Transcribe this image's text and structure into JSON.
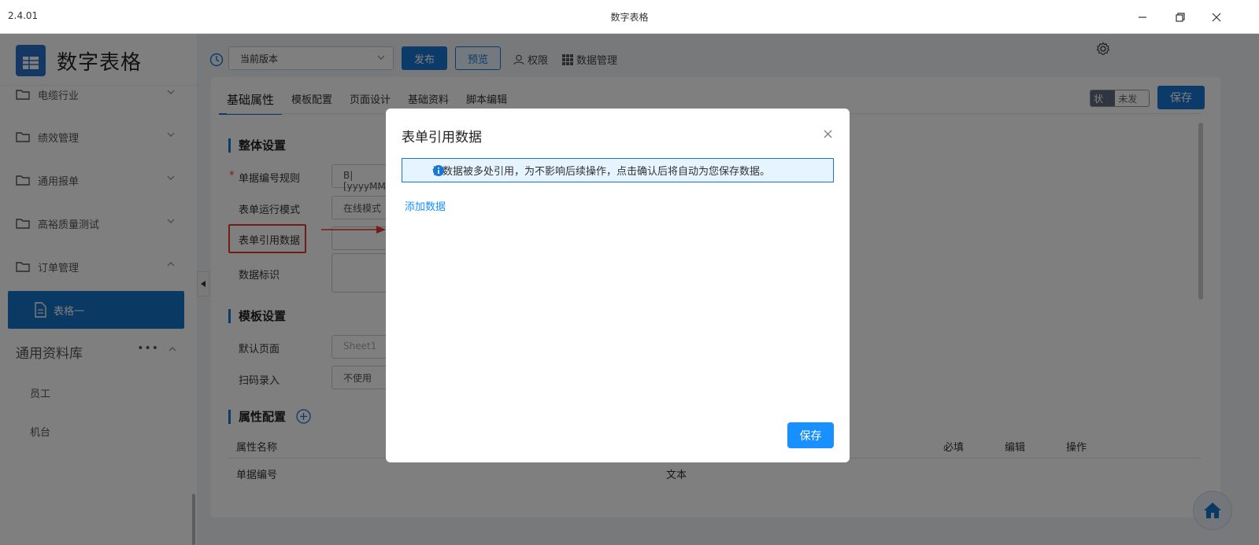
{
  "window": {
    "version": "2.4.01",
    "title": "数字表格"
  },
  "sidebar": {
    "logo_text": "数字表格",
    "items": [
      {
        "label": "电缆行业"
      },
      {
        "label": "绩效管理"
      },
      {
        "label": "通用报单"
      },
      {
        "label": "高裕质量测试"
      },
      {
        "label": "订单管理"
      }
    ],
    "active_item": "表格一",
    "library": {
      "title": "通用资料库",
      "more": "•••",
      "items": [
        "员工",
        "机台"
      ]
    }
  },
  "toolbar": {
    "version_select": "当前版本",
    "publish": "发布",
    "preview": "预览",
    "permission": "权限",
    "data_manage": "数据管理"
  },
  "content": {
    "tabs": [
      "基础属性",
      "模板配置",
      "页面设计",
      "基础资料",
      "脚本编辑"
    ],
    "status_key": "状态",
    "status_value": "未发布",
    "save": "保存",
    "overall": {
      "title": "整体设置",
      "fields": [
        {
          "label": "单据编号规则",
          "value": "B|[yyyyMM"
        },
        {
          "label": "表单运行模式",
          "value": "在线模式"
        },
        {
          "label": "表单引用数据",
          "value": ""
        },
        {
          "label": "数据标识",
          "value": ""
        }
      ]
    },
    "template": {
      "title": "模板设置",
      "fields": [
        {
          "label": "默认页面",
          "value": "Sheet1"
        },
        {
          "label": "扫码录入",
          "value": "不使用"
        }
      ]
    },
    "attr": {
      "title": "属性配置",
      "headers": {
        "name": "属性名称",
        "required": "必填",
        "edit": "编辑",
        "op": "操作"
      },
      "row": {
        "name": "单据编号",
        "type": "文本"
      }
    }
  },
  "modal": {
    "title": "表单引用数据",
    "close": "×",
    "info": "该数据被多处引用，为不影响后续操作，点击确认后将自动为您保存数据。",
    "add_link": "添加数据",
    "save": "保存"
  },
  "colors": {
    "primary": "#1976d2",
    "modal_primary": "#1890ff",
    "highlight_red": "#e53935"
  }
}
